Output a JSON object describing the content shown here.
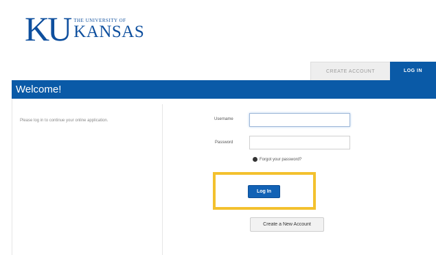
{
  "logo": {
    "ku": "KU",
    "small_text": "THE UNIVERSITY OF",
    "big_text": "KANSAS"
  },
  "tabs": [
    {
      "label": "CREATE ACCOUNT",
      "active": false
    },
    {
      "label": "LOG IN",
      "active": true
    }
  ],
  "header": {
    "title": "Welcome!"
  },
  "intro": {
    "text": "Please log in to continue your online application."
  },
  "form": {
    "username_label": "Username",
    "username_value": "",
    "password_label": "Password",
    "password_value": "",
    "forgot_link": "Forgot your password?",
    "login_button": "Log In",
    "create_button": "Create a New Account"
  },
  "colors": {
    "brand_blue": "#0a5aa7",
    "highlight": "#f3c12e"
  }
}
